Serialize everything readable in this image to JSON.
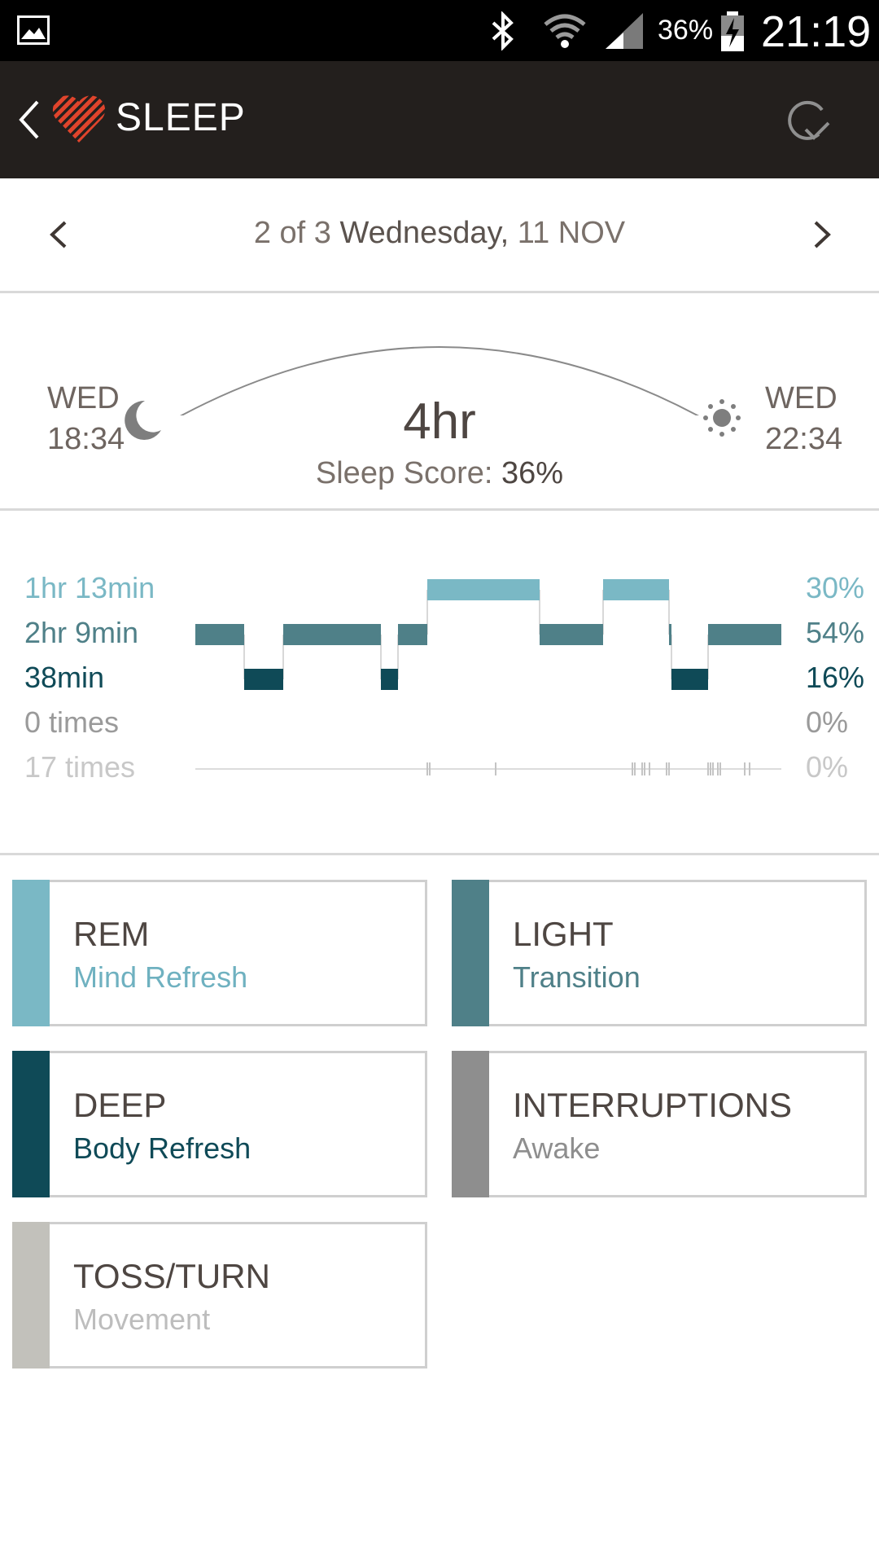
{
  "status_bar": {
    "battery": "36%",
    "time": "21:19",
    "icons": [
      "gallery-icon",
      "bluetooth-icon",
      "wifi-icon",
      "signal-icon",
      "battery-charging-icon"
    ]
  },
  "app_bar": {
    "title": "SLEEP",
    "icons": [
      "back-icon",
      "heart-logo-icon",
      "sync-icon"
    ]
  },
  "date_nav": {
    "position": "2 of 3",
    "day": "Wednesday,",
    "date": "11 NOV"
  },
  "summary": {
    "start_day": "WED",
    "start_time": "18:34",
    "end_day": "WED",
    "end_time": "22:34",
    "duration": "4hr",
    "score_label": "Sleep Score:",
    "score_value": "36%"
  },
  "chart_data": {
    "type": "timeline",
    "total_span_minutes": 240,
    "rows": [
      {
        "name": "REM",
        "label": "1hr 13min",
        "percent": "30%",
        "color": "#7ab8c5"
      },
      {
        "name": "LIGHT",
        "label": "2hr 9min",
        "percent": "54%",
        "color": "#4f8088"
      },
      {
        "name": "DEEP",
        "label": "38min",
        "percent": "16%",
        "color": "#0f4a57"
      },
      {
        "name": "INTERRUPTIONS",
        "label": "0 times",
        "percent": "0%",
        "color": "#9a9a9a"
      },
      {
        "name": "TOSS/TURN",
        "label": "17 times",
        "percent": "0%",
        "color": "#c8c8c8"
      }
    ],
    "segments": [
      {
        "stage": "LIGHT",
        "start": 0,
        "end": 20
      },
      {
        "stage": "DEEP",
        "start": 20,
        "end": 36
      },
      {
        "stage": "LIGHT",
        "start": 36,
        "end": 76
      },
      {
        "stage": "DEEP",
        "start": 76,
        "end": 83
      },
      {
        "stage": "LIGHT",
        "start": 83,
        "end": 95
      },
      {
        "stage": "REM",
        "start": 95,
        "end": 141
      },
      {
        "stage": "LIGHT",
        "start": 141,
        "end": 167
      },
      {
        "stage": "REM",
        "start": 167,
        "end": 194
      },
      {
        "stage": "LIGHT",
        "start": 194,
        "end": 195
      },
      {
        "stage": "DEEP",
        "start": 195,
        "end": 210
      },
      {
        "stage": "LIGHT",
        "start": 210,
        "end": 240
      }
    ],
    "toss_turn_minutes": [
      95,
      96,
      123,
      179,
      180,
      183,
      184,
      186,
      193,
      194,
      210,
      211,
      212,
      214,
      215,
      225,
      227
    ]
  },
  "legend_cards": [
    {
      "name": "REM",
      "sub": "Mind Refresh",
      "color": "#7ab8c5",
      "sub_color": "#6fb1c0"
    },
    {
      "name": "LIGHT",
      "sub": "Transition",
      "color": "#4f8088",
      "sub_color": "#4f8088"
    },
    {
      "name": "DEEP",
      "sub": "Body Refresh",
      "color": "#0f4a57",
      "sub_color": "#0f4a57"
    },
    {
      "name": "INTERRUPTIONS",
      "sub": "Awake",
      "color": "#8e8e8e",
      "sub_color": "#8e8e8e"
    },
    {
      "name": "TOSS/TURN",
      "sub": "Movement",
      "color": "#c2c1bb",
      "sub_color": "#bdbdbd"
    }
  ]
}
